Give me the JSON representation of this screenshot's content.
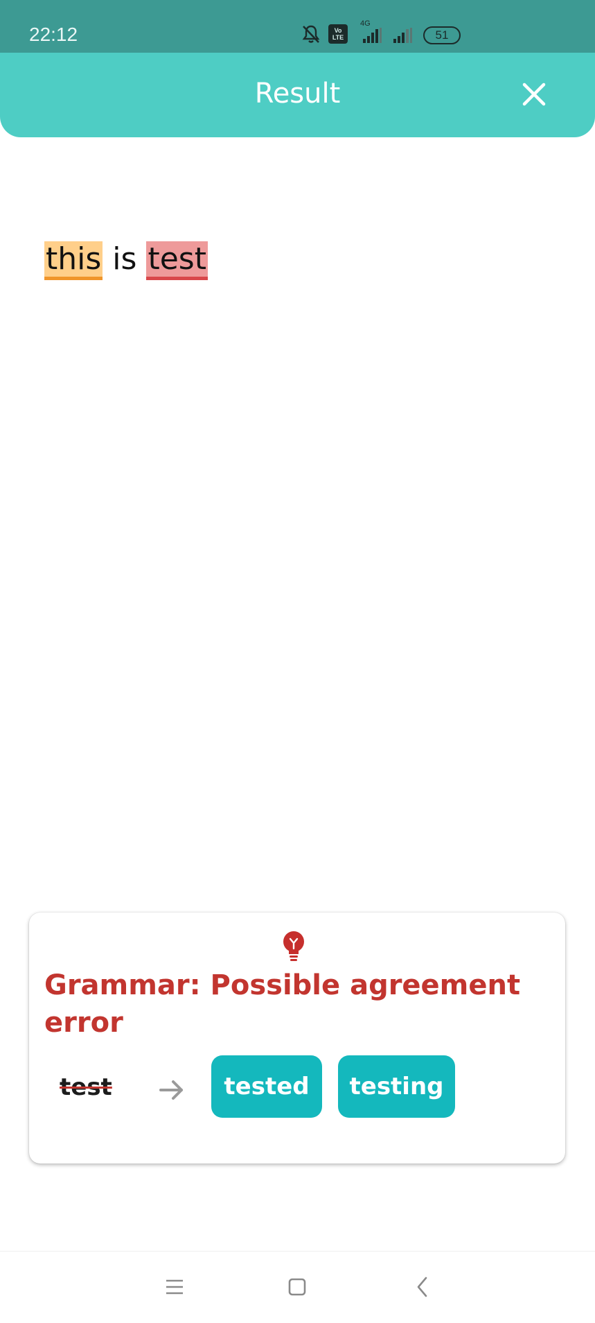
{
  "status_bar": {
    "time": "22:12",
    "network_label": "4G",
    "lte_label_top": "Vo",
    "lte_label_bottom": "LTE",
    "battery": "51"
  },
  "app_bar": {
    "title": "Result",
    "close_icon": "close-icon",
    "color": "#4ecdc4"
  },
  "result": {
    "words": [
      {
        "text": "this",
        "highlight": "warning",
        "color": "#ffcf8a"
      },
      {
        "text": "is",
        "highlight": "none"
      },
      {
        "text": "test",
        "highlight": "error",
        "color": "#ee9a9a"
      }
    ]
  },
  "suggestion_card": {
    "icon": "lightbulb-icon",
    "title": "Grammar: Possible agreement error",
    "original": "test",
    "arrow_icon": "arrow-right-icon",
    "suggestions": [
      "tested",
      "testing"
    ],
    "title_color": "#c2352f",
    "button_color": "#14b8bd"
  },
  "nav_bar": {
    "icons": [
      "menu-icon",
      "home-square-icon",
      "back-chevron-icon"
    ]
  }
}
